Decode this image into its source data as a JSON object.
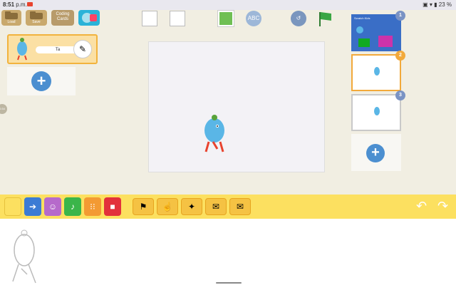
{
  "status": {
    "time": "8:51",
    "ampm": "p.m.",
    "battery": "23 %"
  },
  "toolbar": {
    "load_label": "Load",
    "save_label": "Save",
    "coding_cards_label": "Coding Cards"
  },
  "sprite": {
    "name": "Ta"
  },
  "side_tab_label": "0:34",
  "pages": [
    {
      "number": "1",
      "title": "Scratch Kids"
    },
    {
      "number": "2"
    },
    {
      "number": "3"
    }
  ]
}
